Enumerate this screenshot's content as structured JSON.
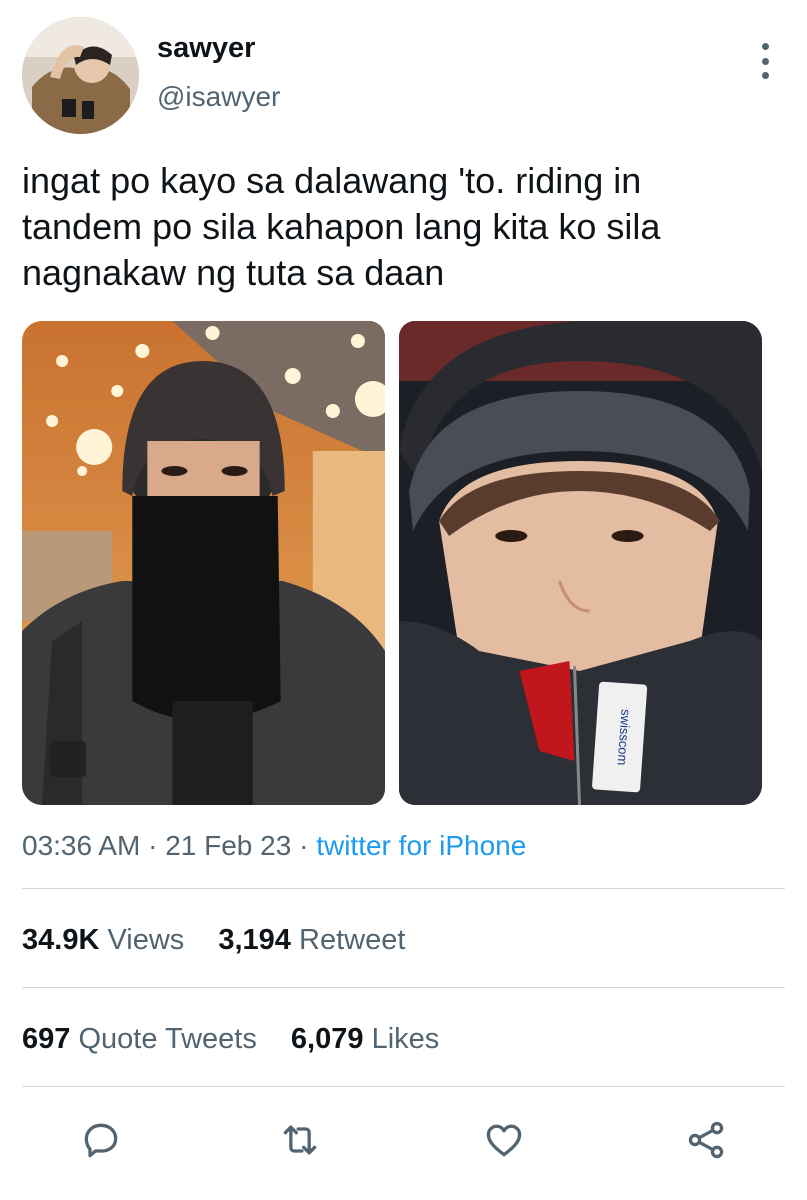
{
  "user": {
    "display_name": "sawyer",
    "handle": "@isawyer"
  },
  "tweet": {
    "text": "ingat po kayo sa dalawang 'to. riding in\ntandem po sila kahapon lang kita ko sila\nnagnakaw ng tuta sa daan",
    "time": "03:36 AM",
    "date": "21 Feb 23",
    "separator": "·",
    "source": "twitter for iPhone"
  },
  "photos": [
    {
      "jacket_logo": ""
    },
    {
      "jacket_logo": "swisscom"
    }
  ],
  "stats": {
    "views_count": "34.9K",
    "views_label": "Views",
    "retweets_count": "3,194",
    "retweets_label": "Retweet",
    "quotes_count": "697",
    "quotes_label": "Quote Tweets",
    "likes_count": "6,079",
    "likes_label": "Likes"
  },
  "actions": [
    "reply-icon",
    "retweet-icon",
    "like-icon",
    "share-icon"
  ],
  "colors": {
    "text": "#0f1419",
    "secondary": "#536471",
    "link": "#1d9bf0",
    "divider": "#cfd9de"
  }
}
